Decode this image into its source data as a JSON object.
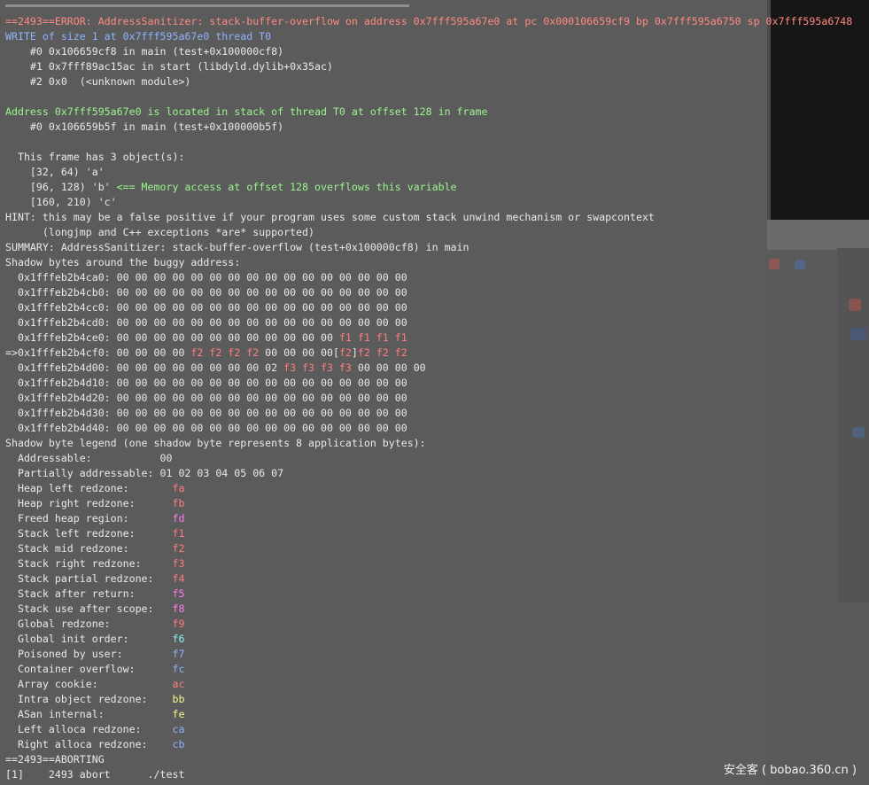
{
  "lines": [
    [
      {
        "t": "==2493==ERROR: AddressSanitizer: stack-buffer-overflow on address 0x7fff595a67e0 at pc 0x000106659cf9 bp 0x7fff595a6750 sp 0x7fff595a6748",
        "c": "red"
      }
    ],
    [
      {
        "t": "WRITE of size 1 at 0x7fff595a67e0 thread T0",
        "c": "blue"
      }
    ],
    [
      {
        "t": "    #0 0x106659cf8 in main (test+0x100000cf8)"
      }
    ],
    [
      {
        "t": "    #1 0x7fff89ac15ac in start (libdyld.dylib+0x35ac)"
      }
    ],
    [
      {
        "t": "    #2 0x0  (<unknown module>)"
      }
    ],
    [
      {
        "t": ""
      }
    ],
    [
      {
        "t": "Address 0x7fff595a67e0 is located in stack of thread T0 at offset 128 in frame",
        "c": "green"
      }
    ],
    [
      {
        "t": "    #0 0x106659b5f in main (test+0x100000b5f)"
      }
    ],
    [
      {
        "t": ""
      }
    ],
    [
      {
        "t": "  This frame has 3 object(s):"
      }
    ],
    [
      {
        "t": "    [32, 64) 'a'"
      }
    ],
    [
      {
        "t": "    [96, 128) 'b' "
      },
      {
        "t": "<== Memory access at offset 128 overflows this variable",
        "c": "green"
      }
    ],
    [
      {
        "t": "    [160, 210) 'c'"
      }
    ],
    [
      {
        "t": "HINT: this may be a false positive if your program uses some custom stack unwind mechanism or swapcontext"
      }
    ],
    [
      {
        "t": "      (longjmp and C++ exceptions *are* supported)"
      }
    ],
    [
      {
        "t": "SUMMARY: AddressSanitizer: stack-buffer-overflow (test+0x100000cf8) in main"
      }
    ],
    [
      {
        "t": "Shadow bytes around the buggy address:"
      }
    ],
    [
      {
        "t": "  0x1fffeb2b4ca0: 00 00 00 00 00 00 00 00 00 00 00 00 00 00 00 00"
      }
    ],
    [
      {
        "t": "  0x1fffeb2b4cb0: 00 00 00 00 00 00 00 00 00 00 00 00 00 00 00 00"
      }
    ],
    [
      {
        "t": "  0x1fffeb2b4cc0: 00 00 00 00 00 00 00 00 00 00 00 00 00 00 00 00"
      }
    ],
    [
      {
        "t": "  0x1fffeb2b4cd0: 00 00 00 00 00 00 00 00 00 00 00 00 00 00 00 00"
      }
    ],
    [
      {
        "t": "  0x1fffeb2b4ce0: 00 00 00 00 00 00 00 00 00 00 00 00 "
      },
      {
        "t": "f1 f1 f1 f1",
        "c": "pink"
      }
    ],
    [
      {
        "t": "=>0x1fffeb2b4cf0: 00 00 00 00 "
      },
      {
        "t": "f2 f2 f2 f2",
        "c": "pink"
      },
      {
        "t": " 00 00 00 00["
      },
      {
        "t": "f2",
        "c": "pink"
      },
      {
        "t": "]"
      },
      {
        "t": "f2 f2 f2",
        "c": "pink"
      }
    ],
    [
      {
        "t": "  0x1fffeb2b4d00: 00 00 00 00 00 00 00 00 02 "
      },
      {
        "t": "f3 f3 f3 f3",
        "c": "pink"
      },
      {
        "t": " 00 00 00 00"
      }
    ],
    [
      {
        "t": "  0x1fffeb2b4d10: 00 00 00 00 00 00 00 00 00 00 00 00 00 00 00 00"
      }
    ],
    [
      {
        "t": "  0x1fffeb2b4d20: 00 00 00 00 00 00 00 00 00 00 00 00 00 00 00 00"
      }
    ],
    [
      {
        "t": "  0x1fffeb2b4d30: 00 00 00 00 00 00 00 00 00 00 00 00 00 00 00 00"
      }
    ],
    [
      {
        "t": "  0x1fffeb2b4d40: 00 00 00 00 00 00 00 00 00 00 00 00 00 00 00 00"
      }
    ],
    [
      {
        "t": "Shadow byte legend (one shadow byte represents 8 application bytes):"
      }
    ],
    [
      {
        "t": "  Addressable:           00"
      }
    ],
    [
      {
        "t": "  Partially addressable: 01 02 03 04 05 06 07"
      }
    ],
    [
      {
        "t": "  Heap left redzone:       "
      },
      {
        "t": "fa",
        "c": "pink"
      }
    ],
    [
      {
        "t": "  Heap right redzone:      "
      },
      {
        "t": "fb",
        "c": "pink"
      }
    ],
    [
      {
        "t": "  Freed heap region:       "
      },
      {
        "t": "fd",
        "c": "mag"
      }
    ],
    [
      {
        "t": "  Stack left redzone:      "
      },
      {
        "t": "f1",
        "c": "pink"
      }
    ],
    [
      {
        "t": "  Stack mid redzone:       "
      },
      {
        "t": "f2",
        "c": "pink"
      }
    ],
    [
      {
        "t": "  Stack right redzone:     "
      },
      {
        "t": "f3",
        "c": "pink"
      }
    ],
    [
      {
        "t": "  Stack partial redzone:   "
      },
      {
        "t": "f4",
        "c": "pink"
      }
    ],
    [
      {
        "t": "  Stack after return:      "
      },
      {
        "t": "f5",
        "c": "mag"
      }
    ],
    [
      {
        "t": "  Stack use after scope:   "
      },
      {
        "t": "f8",
        "c": "mag"
      }
    ],
    [
      {
        "t": "  Global redzone:          "
      },
      {
        "t": "f9",
        "c": "pink"
      }
    ],
    [
      {
        "t": "  Global init order:       "
      },
      {
        "t": "f6",
        "c": "cyan"
      }
    ],
    [
      {
        "t": "  Poisoned by user:        "
      },
      {
        "t": "f7",
        "c": "blue"
      }
    ],
    [
      {
        "t": "  Container overflow:      "
      },
      {
        "t": "fc",
        "c": "blue"
      }
    ],
    [
      {
        "t": "  Array cookie:            "
      },
      {
        "t": "ac",
        "c": "pink"
      }
    ],
    [
      {
        "t": "  Intra object redzone:    "
      },
      {
        "t": "bb",
        "c": "yel"
      }
    ],
    [
      {
        "t": "  ASan internal:           "
      },
      {
        "t": "fe",
        "c": "yel"
      }
    ],
    [
      {
        "t": "  Left alloca redzone:     "
      },
      {
        "t": "ca",
        "c": "blue"
      }
    ],
    [
      {
        "t": "  Right alloca redzone:    "
      },
      {
        "t": "cb",
        "c": "blue"
      }
    ],
    [
      {
        "t": "==2493==ABORTING"
      }
    ],
    [
      {
        "t": "[1]    2493 abort      ./test"
      }
    ]
  ],
  "colors": {
    "red": "#ff8a80",
    "blue": "#8db3ff",
    "green": "#9cf58f",
    "pink": "#ff7d80",
    "mag": "#ff7cf2",
    "cyan": "#86f3f0",
    "yel": "#fbf58a",
    "default": "#e9e9e9"
  },
  "watermark": "安全客 ( bobao.360.cn )"
}
